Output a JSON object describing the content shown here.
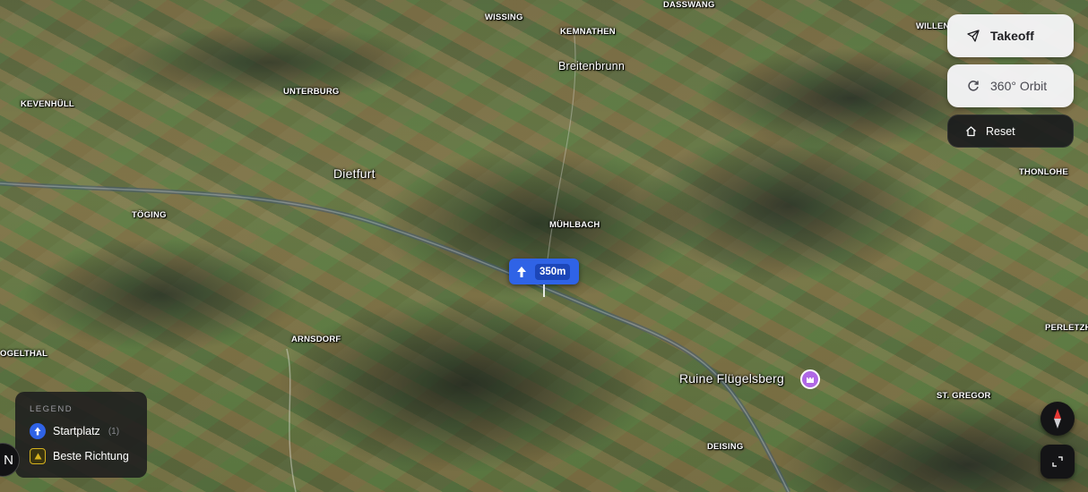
{
  "map": {
    "labels": {
      "wissing": "WISSING",
      "dasswang": "DASSWANG",
      "willen": "WILLEN",
      "kemnathen": "KEMNATHEN",
      "breitenbrunn": "Breitenbrunn",
      "kevenhull": "KEVENHÜLL",
      "unterburg": "UNTERBURG",
      "dietfurt": "Dietfurt",
      "thonlohe": "THONLOHE",
      "toging": "TÖGING",
      "muhlbach": "MÜHLBACH",
      "perletzh": "PERLETZH",
      "arnsdorf": "ARNSDORF",
      "ogelthal": "OGELTHAL",
      "ruine": "Ruine Flügelsberg",
      "stgregor": "ST. GREGOR",
      "deising": "DEISING"
    },
    "marker": {
      "altitude": "350m",
      "icon": "arrow-up-icon"
    },
    "poi_icon": "castle-icon"
  },
  "controls": {
    "takeoff": "Takeoff",
    "orbit": "360° Orbit",
    "reset": "Reset",
    "north": "N"
  },
  "legend": {
    "title": "LEGEND",
    "items": [
      {
        "label": "Startplatz",
        "count": "(1)",
        "color": "#2f63e6"
      },
      {
        "label": "Beste Richtung",
        "color": "#d6b21e"
      }
    ]
  }
}
